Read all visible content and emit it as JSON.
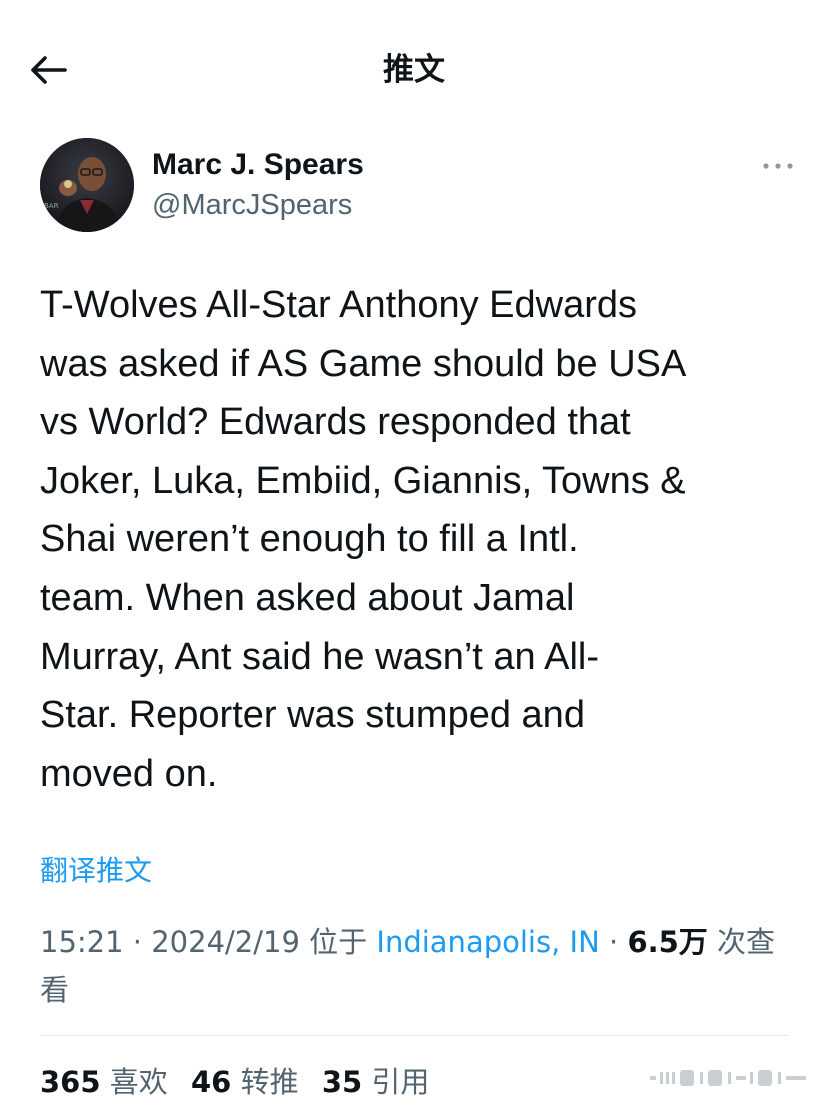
{
  "header": {
    "title": "推文"
  },
  "author": {
    "name": "Marc J. Spears",
    "handle": "@MarcJSpears"
  },
  "tweet": {
    "text": "T-Wolves All-Star Anthony Edwards\nwas asked if AS Game should be USA\nvs World? Edwards responded that\nJoker, Luka, Embiid, Giannis, Towns &\nShai weren’t enough to fill a Intl.\nteam. When asked about Jamal\nMurray, Ant said he wasn’t an All-\nStar. Reporter was stumped and\nmoved on.",
    "translate_label": "翻译推文"
  },
  "meta": {
    "time": "15:21",
    "separator": "·",
    "date": "2024/2/19",
    "location_prefix": "位于",
    "location": "Indianapolis, IN",
    "views_count": "6.5万",
    "views_label": "次查看"
  },
  "stats": {
    "likes_count": "365",
    "likes_label": "喜欢",
    "retweets_count": "46",
    "retweets_label": "转推",
    "quotes_count": "35",
    "quotes_label": "引用"
  },
  "icons": {
    "back": "arrow-left-icon",
    "more": "more-horizontal-icon"
  },
  "colors": {
    "link": "#1d9bf0",
    "secondary_text": "#536471",
    "primary_text": "#0f1419"
  }
}
